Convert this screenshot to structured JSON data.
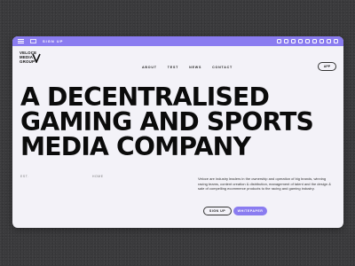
{
  "topbar": {
    "signup_label": "SIGN UP",
    "accent_color": "#8a7cf0"
  },
  "logo": {
    "line1": "VELOCE",
    "line2": "MEDIA",
    "line3": "GROUP"
  },
  "nav": {
    "items": [
      "ABOUT",
      "TEST",
      "NEWS",
      "CONTACT"
    ],
    "app_button": "APP"
  },
  "hero": {
    "headline_lines": [
      "A DECENTRALISED",
      "GAMING AND SPORTS",
      "MEDIA COMPANY"
    ],
    "meta_left": "EST.",
    "meta_right": "HOME",
    "description": "Veloce are industry leaders in the ownership and operation of big brands, winning racing teams, content creation & distribution, management of talent and the design & sale of compelling ecommerce products to the racing and gaming industry.",
    "cta_signup": "SIGN UP",
    "cta_whitepaper": "WHITEPAPER"
  }
}
